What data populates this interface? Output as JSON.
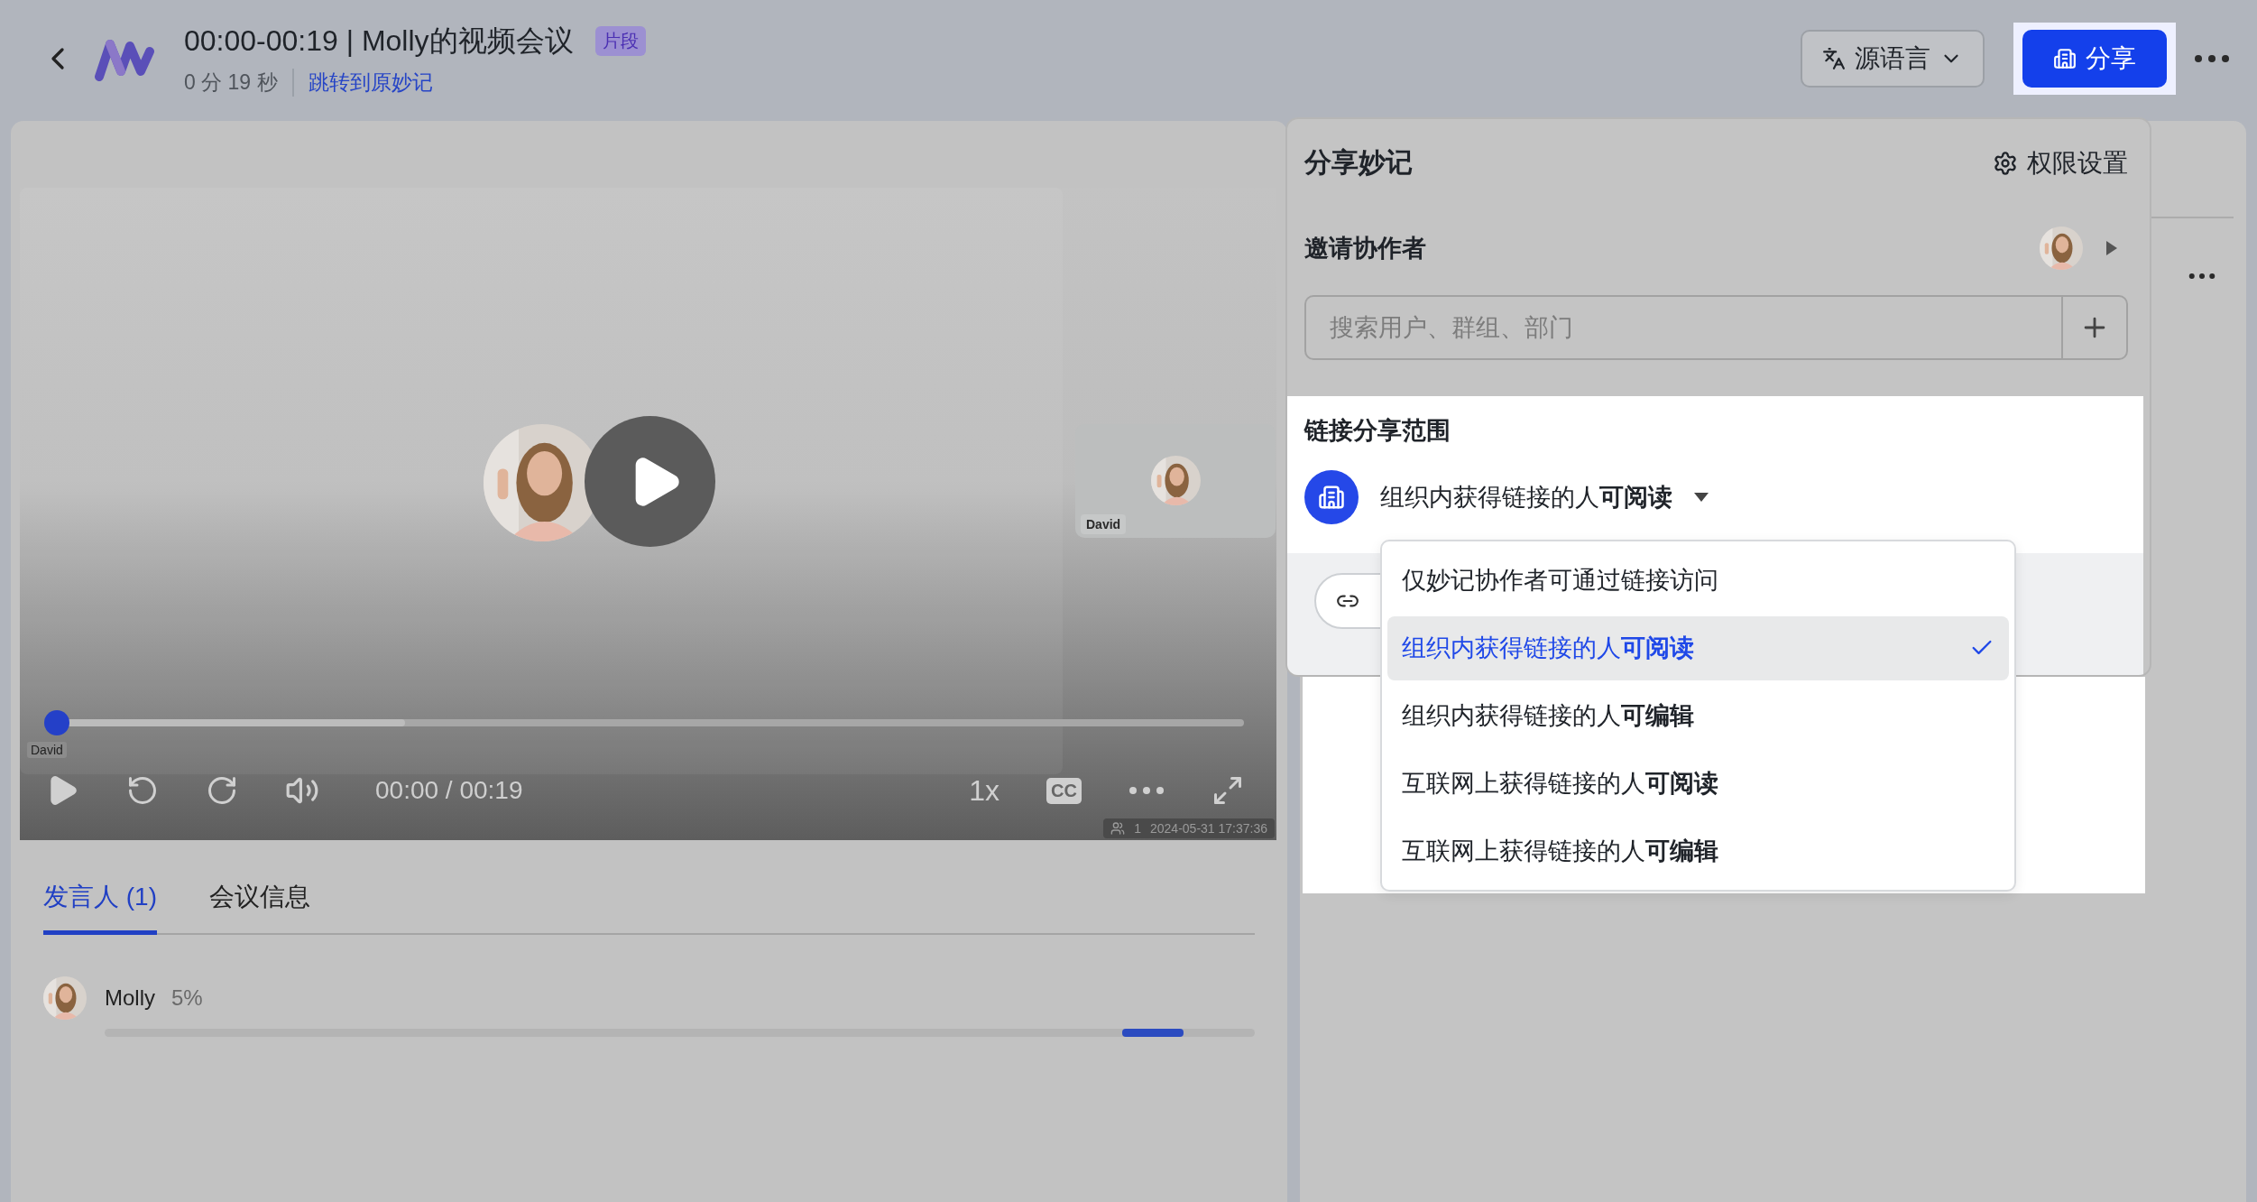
{
  "header": {
    "title": "00:00-00:19 | Molly的视频会议",
    "badge": "片段",
    "duration": "0 分 19 秒",
    "jump_link": "跳转到原妙记",
    "language_button": "源语言",
    "share_button": "分享"
  },
  "video": {
    "thumbnail_label": "David",
    "progress": {
      "level": 0.01,
      "tooltip": "David"
    },
    "time": "00:00 / 00:19",
    "speed": "1x",
    "captions": "CC",
    "participants": "1",
    "recorded_at": "2024-05-31 17:37:36"
  },
  "tabs": [
    {
      "label": "发言人 (1)",
      "selected": true
    },
    {
      "label": "会议信息",
      "selected": false
    }
  ],
  "speakers": [
    {
      "name": "Molly",
      "share": "5%"
    }
  ],
  "share_panel": {
    "title": "分享妙记",
    "settings": "权限设置",
    "invite_label": "邀请协作者",
    "search": {
      "placeholder": "搜索用户、群组、部门"
    },
    "scope_label": "链接分享范围",
    "scope_value": "组织内获得链接的人**可阅读**",
    "scope_options": [
      {
        "label": "仅妙记协作者可通过链接访问",
        "selected": false
      },
      {
        "label": "组织内获得链接的人**可阅读**",
        "selected": true
      },
      {
        "label": "组织内获得链接的人**可编辑**",
        "selected": false
      },
      {
        "label": "互联网上获得链接的人**可阅读**",
        "selected": false
      },
      {
        "label": "互联网上获得链接的人**可编辑**",
        "selected": false
      }
    ]
  }
}
